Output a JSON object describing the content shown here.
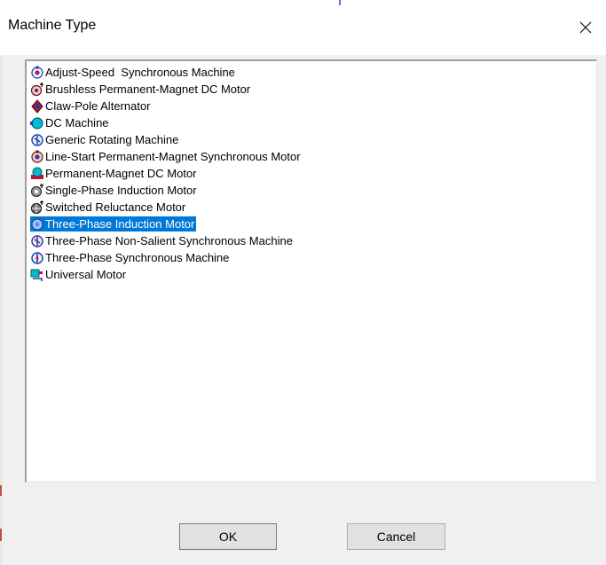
{
  "window": {
    "title": "Machine Type",
    "close_label": "✕"
  },
  "list": {
    "items": [
      {
        "label": "Adjust-Speed  Synchronous Machine",
        "icon": "synchronous-machine-icon",
        "selected": false
      },
      {
        "label": "Brushless Permanent-Magnet DC Motor",
        "icon": "brushless-motor-icon",
        "selected": false
      },
      {
        "label": "Claw-Pole Alternator",
        "icon": "claw-pole-alternator-icon",
        "selected": false
      },
      {
        "label": "DC Machine",
        "icon": "dc-machine-icon",
        "selected": false
      },
      {
        "label": "Generic Rotating Machine",
        "icon": "rotating-machine-icon",
        "selected": false
      },
      {
        "label": "Line-Start Permanent-Magnet Synchronous Motor",
        "icon": "line-start-motor-icon",
        "selected": false
      },
      {
        "label": "Permanent-Magnet DC Motor",
        "icon": "pm-dc-motor-icon",
        "selected": false
      },
      {
        "label": "Single-Phase Induction Motor",
        "icon": "single-phase-motor-icon",
        "selected": false
      },
      {
        "label": "Switched Reluctance Motor",
        "icon": "reluctance-motor-icon",
        "selected": false
      },
      {
        "label": "Three-Phase Induction Motor",
        "icon": "three-phase-induction-icon",
        "selected": true
      },
      {
        "label": "Three-Phase Non-Salient Synchronous Machine",
        "icon": "non-salient-machine-icon",
        "selected": false
      },
      {
        "label": "Three-Phase Synchronous Machine",
        "icon": "three-phase-synchronous-icon",
        "selected": false
      },
      {
        "label": "Universal Motor",
        "icon": "universal-motor-icon",
        "selected": false
      }
    ]
  },
  "buttons": {
    "ok_label": "OK",
    "cancel_label": "Cancel"
  },
  "colors": {
    "selection": "#0078d7",
    "button_face": "#e1e1e1",
    "dialog_bg": "#f0f0f0"
  }
}
